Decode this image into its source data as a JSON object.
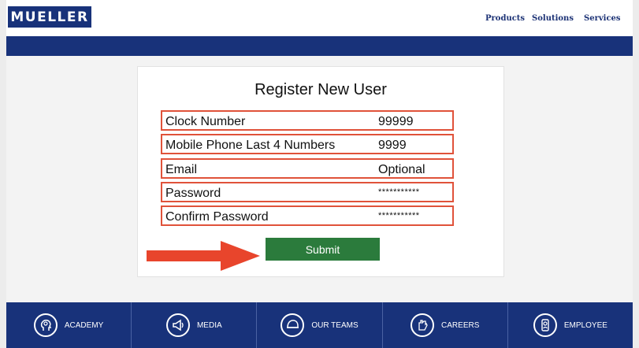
{
  "header": {
    "logo": "MUELLER",
    "nav": [
      "Products",
      "Solutions",
      "Services"
    ]
  },
  "form": {
    "title": "Register New User",
    "fields": [
      {
        "label": "Clock Number",
        "value": "99999"
      },
      {
        "label": "Mobile Phone Last 4 Numbers",
        "value": "9999"
      },
      {
        "label": "Email",
        "value": "Optional"
      },
      {
        "label": "Password",
        "value": "***********"
      },
      {
        "label": "Confirm Password",
        "value": "***********"
      }
    ],
    "submit_label": "Submit"
  },
  "annotation": {
    "arrow_color": "#e8452c",
    "field_outline_color": "#e0523a"
  },
  "footer": {
    "items": [
      {
        "label": "ACADEMY",
        "icon": "academy-head-icon"
      },
      {
        "label": "MEDIA",
        "icon": "media-megaphone-icon"
      },
      {
        "label": "OUR TEAMS",
        "icon": "teams-helmet-icon"
      },
      {
        "label": "CAREERS",
        "icon": "careers-hand-icon"
      },
      {
        "label": "EMPLOYEE",
        "icon": "employee-badge-icon"
      }
    ]
  },
  "colors": {
    "brand_navy": "#18327a",
    "submit_green": "#2b7b3c"
  }
}
